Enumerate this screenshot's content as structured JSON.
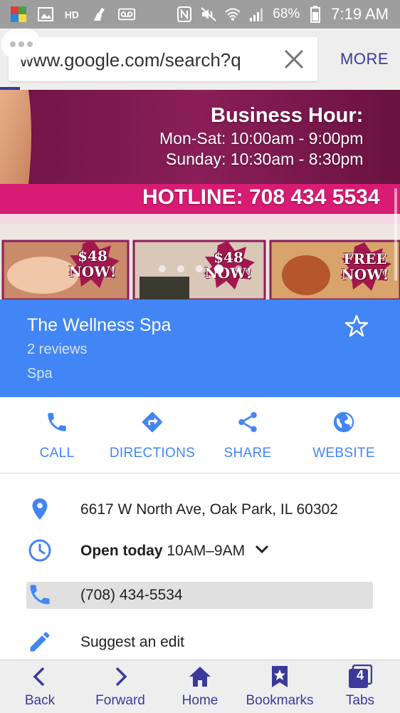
{
  "status_bar": {
    "battery_percent": "68%",
    "time": "7:19 AM",
    "icons": [
      "app-icon",
      "image-icon",
      "hd-icon",
      "broom-icon",
      "voicemail-icon",
      "nfc-icon",
      "mute-icon",
      "wifi-icon",
      "signal-icon",
      "battery-icon"
    ]
  },
  "browser": {
    "url": "www.google.com/search?q",
    "more_label": "MORE"
  },
  "photo": {
    "business_hour_title": "Business Hour:",
    "hours_line1": "Mon-Sat: 10:00am - 9:00pm",
    "hours_line2": "Sunday: 10:30am - 8:30pm",
    "hotline": "HOTLINE: 708 434 5534",
    "badges": [
      {
        "line1": "$48",
        "line2": "NOW!"
      },
      {
        "line1": "$48",
        "line2": "NOW!"
      },
      {
        "line1": "FREE",
        "line2": "NOW!"
      }
    ],
    "carousel_count": 5,
    "carousel_active_index": 3
  },
  "place": {
    "name": "The Wellness Spa",
    "reviews": "2 reviews",
    "category": "Spa"
  },
  "actions": {
    "call": "CALL",
    "directions": "DIRECTIONS",
    "share": "SHARE",
    "website": "WEBSITE"
  },
  "info": {
    "address": "6617 W North Ave, Oak Park, IL 60302",
    "hours_status": "Open today",
    "hours_range": "10AM–9AM",
    "phone": "(708) 434-5534",
    "suggest_edit": "Suggest an edit"
  },
  "nav": {
    "back": "Back",
    "forward": "Forward",
    "home": "Home",
    "bookmarks": "Bookmarks",
    "tabs": "Tabs",
    "tabs_count": "4"
  },
  "colors": {
    "accent_blue": "#4285f4",
    "browser_purple": "#3b3a9b",
    "status_bar_gray": "#9e9e9e"
  }
}
